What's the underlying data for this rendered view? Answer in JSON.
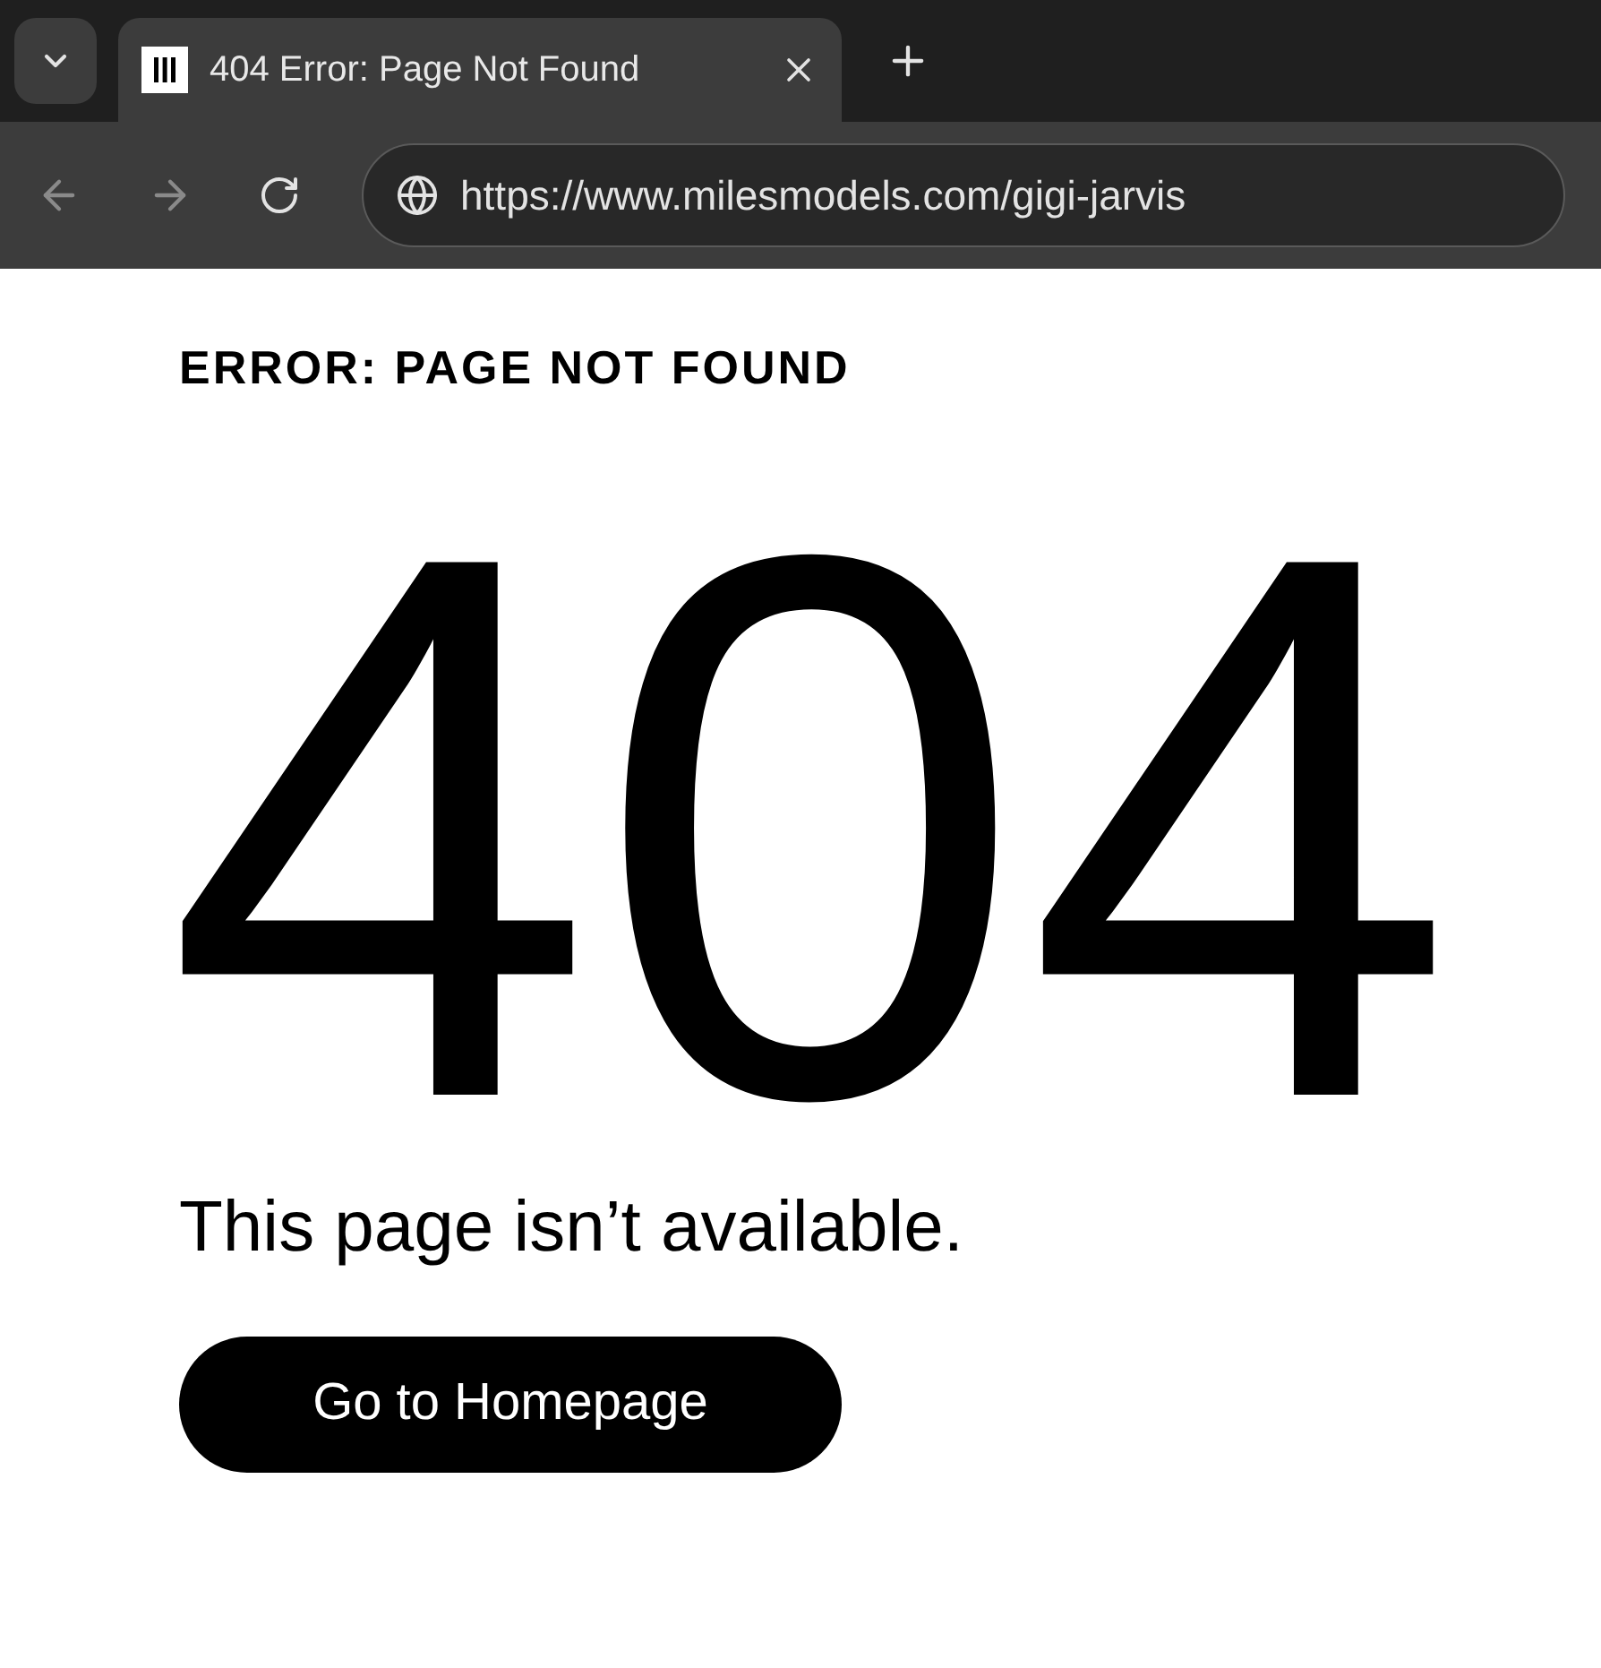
{
  "browser": {
    "tab": {
      "title": "404 Error: Page Not Found",
      "selected": true
    },
    "address": "https://www.milesmodels.com/gigi-jarvis"
  },
  "page": {
    "eyebrow": "ERROR: PAGE NOT FOUND",
    "code": "404",
    "message": "This page isn’t available.",
    "button": "Go to Homepage"
  }
}
